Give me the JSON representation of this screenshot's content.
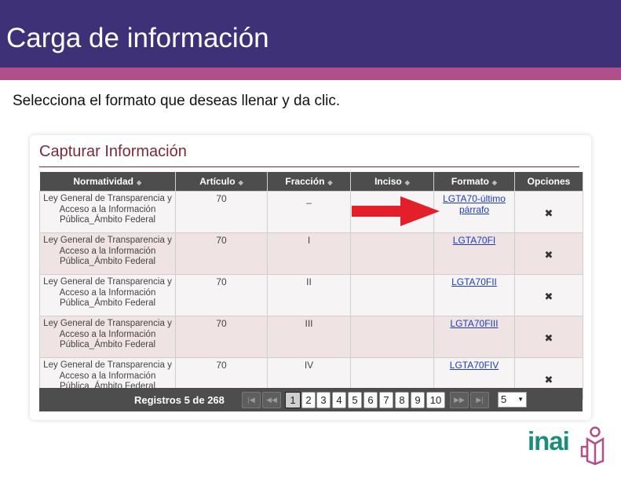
{
  "header": {
    "title": "Carga de información"
  },
  "instruction": "Selecciona el formato que deseas llenar y da clic.",
  "card": {
    "title": "Capturar Información",
    "columns": [
      "Normatividad",
      "Artículo",
      "Fracción",
      "Inciso",
      "Formato",
      "Opciones"
    ],
    "rows": [
      {
        "normatividad": "Ley General de Transparencia y Acceso a la Información Pública_Ámbito Federal",
        "articulo": "70",
        "fraccion": "_",
        "inciso": "",
        "formato": "LGTA70-último párrafo",
        "opciones": "✖"
      },
      {
        "normatividad": "Ley General de Transparencia y Acceso a la Información Pública_Ámbito Federal",
        "articulo": "70",
        "fraccion": "I",
        "inciso": "",
        "formato": "LGTA70FI",
        "opciones": "✖"
      },
      {
        "normatividad": "Ley General de Transparencia y Acceso a la Información Pública_Ámbito Federal",
        "articulo": "70",
        "fraccion": "II",
        "inciso": "",
        "formato": "LGTA70FII",
        "opciones": "✖"
      },
      {
        "normatividad": "Ley General de Transparencia y Acceso a la Información Pública_Ámbito Federal",
        "articulo": "70",
        "fraccion": "III",
        "inciso": "",
        "formato": "LGTA70FIII",
        "opciones": "✖"
      },
      {
        "normatividad": "Ley General de Transparencia y Acceso a la Información Pública_Ámbito Federal",
        "articulo": "70",
        "fraccion": "IV",
        "inciso": "",
        "formato": "LGTA70FIV",
        "opciones": "✖"
      }
    ],
    "footer": {
      "registros": "Registros 5 de 268",
      "pages": [
        "1",
        "2",
        "3",
        "4",
        "5",
        "6",
        "7",
        "8",
        "9",
        "10"
      ],
      "current_page": "1",
      "page_size": "5"
    }
  },
  "logo": {
    "text": "inai"
  },
  "colors": {
    "header": "#3f3178",
    "accent_bar": "#b0508a",
    "title": "#7a2a3a",
    "logo": "#1b8e7a",
    "arrow": "#e3202a"
  }
}
